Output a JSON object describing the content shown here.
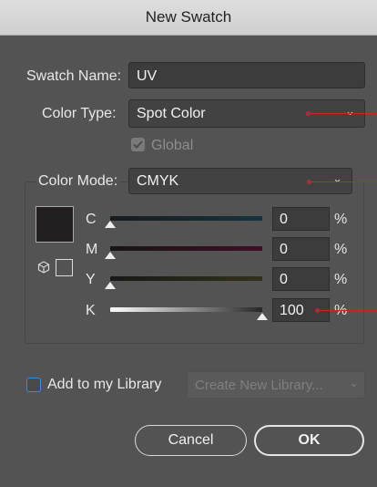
{
  "window": {
    "title": "New Swatch"
  },
  "swatch_name": {
    "label": "Swatch Name:",
    "value": "UV"
  },
  "color_type": {
    "label": "Color Type:",
    "value": "Spot Color"
  },
  "global": {
    "label": "Global",
    "checked": true
  },
  "color_mode": {
    "label": "Color Mode:",
    "value": "CMYK"
  },
  "channels": [
    {
      "name": "C",
      "value": "0",
      "unit": "%"
    },
    {
      "name": "M",
      "value": "0",
      "unit": "%"
    },
    {
      "name": "Y",
      "value": "0",
      "unit": "%"
    },
    {
      "name": "K",
      "value": "100",
      "unit": "%"
    }
  ],
  "library": {
    "checkbox_label": "Add to my Library",
    "checked": false,
    "dropdown_placeholder": "Create New Library..."
  },
  "buttons": {
    "cancel": "Cancel",
    "ok": "OK"
  },
  "colors": {
    "swatch_preview": "#231f20",
    "pointer_red": "#c8242b"
  }
}
